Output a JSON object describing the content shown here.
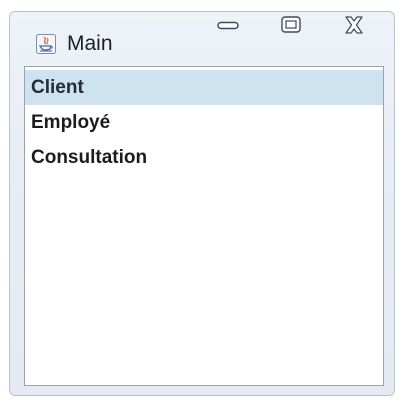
{
  "window": {
    "title": "Main",
    "icons": {
      "app": "java-app-icon",
      "minimize": "minimize-icon",
      "maximize": "maximize-icon",
      "close": "close-icon"
    }
  },
  "list": {
    "items": [
      {
        "label": "Client",
        "selected": true
      },
      {
        "label": "Employé",
        "selected": false
      },
      {
        "label": "Consultation",
        "selected": false
      }
    ]
  },
  "colors": {
    "selection": "#cfe2f0",
    "frame": "#e7edf4",
    "border": "#9aa3ad"
  }
}
